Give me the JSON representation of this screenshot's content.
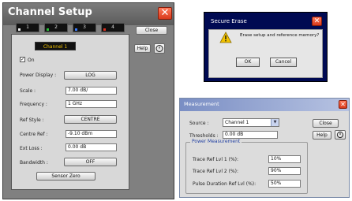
{
  "channel_setup": {
    "title": "Channel Setup",
    "tabs": [
      {
        "label": "1",
        "color": "#f2f2f2"
      },
      {
        "label": "2",
        "color": "#2bbf3a"
      },
      {
        "label": "3",
        "color": "#3a7cff"
      },
      {
        "label": "4",
        "color": "#e03020"
      }
    ],
    "channel_label": "Channel 1",
    "on_label": "On",
    "on_checked": true,
    "power_display": {
      "label": "Power Display :",
      "value": "LOG"
    },
    "scale": {
      "label": "Scale :",
      "value": "7.00 dB/"
    },
    "frequency": {
      "label": "Frequency :",
      "value": "1 GHz"
    },
    "ref_style": {
      "label": "Ref Style :",
      "value": "CENTRE"
    },
    "centre_ref": {
      "label": "Centre Ref :",
      "value": "-9.10 dBm"
    },
    "ext_loss": {
      "label": "Ext Loss :",
      "value": "0.00 dB"
    },
    "bandwidth": {
      "label": "Bandwidth :",
      "value": "OFF"
    },
    "sensor_zero": "Sensor Zero",
    "close": "Close",
    "help": "Help"
  },
  "secure_erase": {
    "title": "Secure Erase",
    "message": "Erase setup and reference memory?",
    "ok": "OK",
    "cancel": "Cancel"
  },
  "measurement": {
    "title": "Measurement",
    "source_label": "Source :",
    "source_value": "Channel 1",
    "thresholds_label": "Thresholds :",
    "thresholds_value": "0.00 dB",
    "close": "Close",
    "help": "Help",
    "group_title": "Power Measurement",
    "rows": [
      {
        "label": "Trace Ref Lvl 1 (%):",
        "value": "10%"
      },
      {
        "label": "Trace Ref Lvl 2 (%):",
        "value": "90%"
      },
      {
        "label": "Pulse Duration Ref Lvl (%):",
        "value": "50%"
      }
    ]
  }
}
